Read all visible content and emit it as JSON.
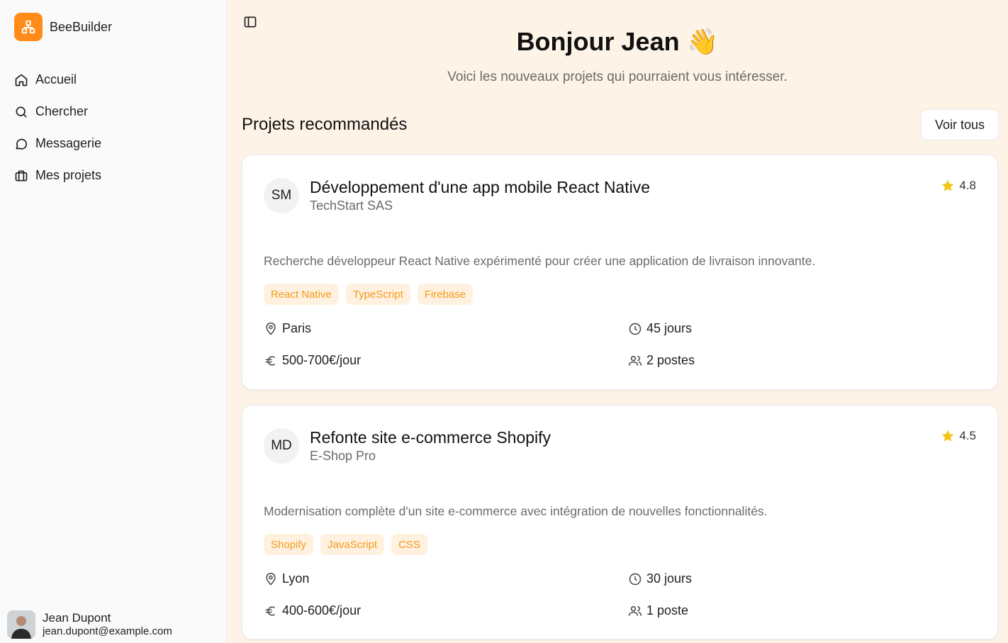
{
  "app": {
    "name": "BeeBuilder",
    "accent": "#ff8c1a"
  },
  "sidebar": {
    "items": [
      {
        "label": "Accueil",
        "icon": "home-icon"
      },
      {
        "label": "Chercher",
        "icon": "search-icon"
      },
      {
        "label": "Messagerie",
        "icon": "message-icon"
      },
      {
        "label": "Mes projets",
        "icon": "briefcase-icon"
      }
    ],
    "user": {
      "name": "Jean Dupont",
      "email": "jean.dupont@example.com"
    }
  },
  "header": {
    "greeting": "Bonjour Jean",
    "greeting_emoji": "👋",
    "subtitle": "Voici les nouveaux projets qui pourraient vous intéresser."
  },
  "section": {
    "title": "Projets recommandés",
    "see_all_label": "Voir tous"
  },
  "projects": [
    {
      "initials": "SM",
      "title": "Développement d'une app mobile React Native",
      "company": "TechStart SAS",
      "rating": "4.8",
      "description": "Recherche développeur React Native expérimenté pour créer une application de livraison innovante.",
      "tags": [
        "React Native",
        "TypeScript",
        "Firebase"
      ],
      "location": "Paris",
      "duration": "45 jours",
      "rate": "500-700€/jour",
      "positions": "2 postes"
    },
    {
      "initials": "MD",
      "title": "Refonte site e-commerce Shopify",
      "company": "E-Shop Pro",
      "rating": "4.5",
      "description": "Modernisation complète d'un site e-commerce avec intégration de nouvelles fonctionnalités.",
      "tags": [
        "Shopify",
        "JavaScript",
        "CSS"
      ],
      "location": "Lyon",
      "duration": "30 jours",
      "rate": "400-600€/jour",
      "positions": "1 poste"
    }
  ]
}
